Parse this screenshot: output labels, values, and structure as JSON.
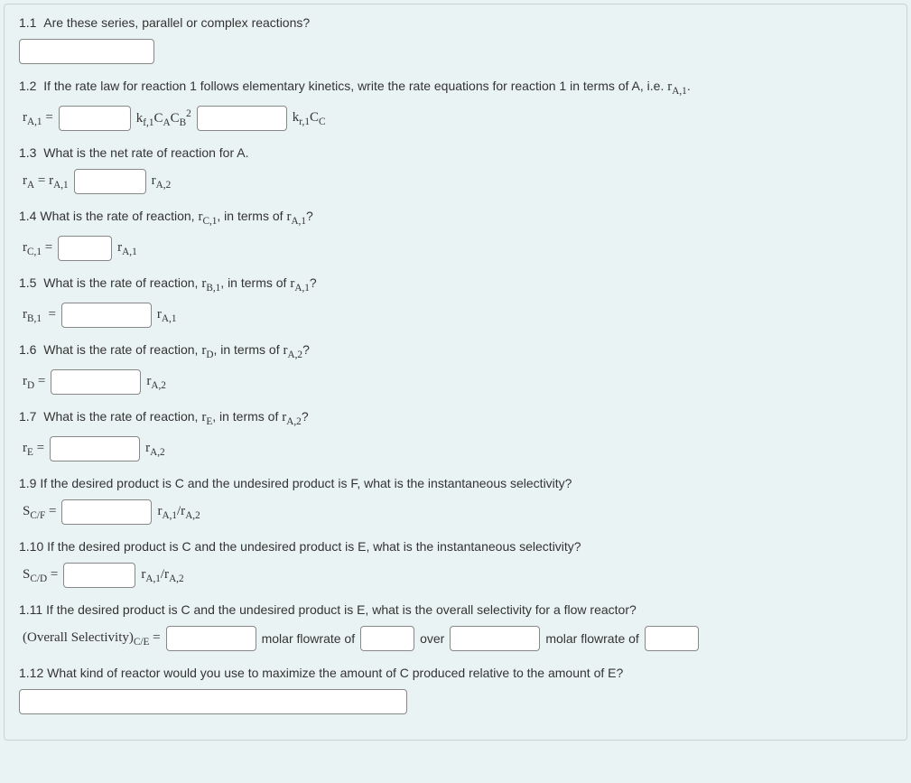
{
  "q1_1": {
    "num": "1.1",
    "text": "Are these series, parallel or complex reactions?"
  },
  "q1_2": {
    "num": "1.2",
    "text": "If the rate law for reaction 1 follows elementary kinetics, write the rate equations for reaction 1 in terms of A, i.e. ",
    "suffix_var": "rA,1",
    "suffix_dot": ".",
    "lhs": "rA,1 =",
    "mid1_a": "kf,1",
    "mid1_b": "CA",
    "mid1_c": "CB",
    "mid1_d": "2",
    "mid2_a": "kr,1",
    "mid2_b": "CC"
  },
  "q1_3": {
    "num": "1.3",
    "text": "What is the net rate of reaction for A.",
    "lhs": "rA = rA,1",
    "rhs": "rA,2"
  },
  "q1_4": {
    "num": "1.4",
    "text": "What is the rate of reaction, ",
    "var1": "rC,1",
    "text2": ", in terms of ",
    "var2": "rA,1",
    "text3": "?",
    "lhs": "rC,1 =",
    "rhs": "rA,1"
  },
  "q1_5": {
    "num": "1.5",
    "text": "What is the rate of reaction, ",
    "var1": "rB,1",
    "text2": ", in terms of ",
    "var2": "rA,1",
    "text3": "?",
    "lhs": "rB,1  =",
    "rhs": "rA,1"
  },
  "q1_6": {
    "num": "1.6",
    "text": "What is the rate of reaction, ",
    "var1": "rD",
    "text2": ", in terms of ",
    "var2": "rA,2",
    "text3": "?",
    "lhs": "rD =",
    "rhs": "rA,2"
  },
  "q1_7": {
    "num": "1.7",
    "text": "What is the rate of reaction, ",
    "var1": "rE",
    "text2": ", in terms of ",
    "var2": "rA,2",
    "text3": "?",
    "lhs": "rE =",
    "rhs": "rA,2"
  },
  "q1_9": {
    "num": "1.9",
    "text": "If the desired product is C and the undesired product is F, what is the instantaneous selectivity?",
    "lhs": "SC/F =",
    "rhs": "rA,1/rA,2"
  },
  "q1_10": {
    "num": "1.10",
    "text": "If the desired product is C and the undesired product is E, what is the instantaneous selectivity?",
    "lhs": "SC/D =",
    "rhs": "rA,1/rA,2"
  },
  "q1_11": {
    "num": "1.11",
    "text": "If the desired product is C and the undesired product is E, what is the overall selectivity for a flow reactor?",
    "lhs": "(Overall Selectivity)C/E =",
    "mid1": "molar flowrate of",
    "mid2": "over",
    "mid3": "molar flowrate of"
  },
  "q1_12": {
    "num": "1.12",
    "text": "What kind of reactor would you use to maximize the amount of C produced relative to the amount of E?"
  }
}
